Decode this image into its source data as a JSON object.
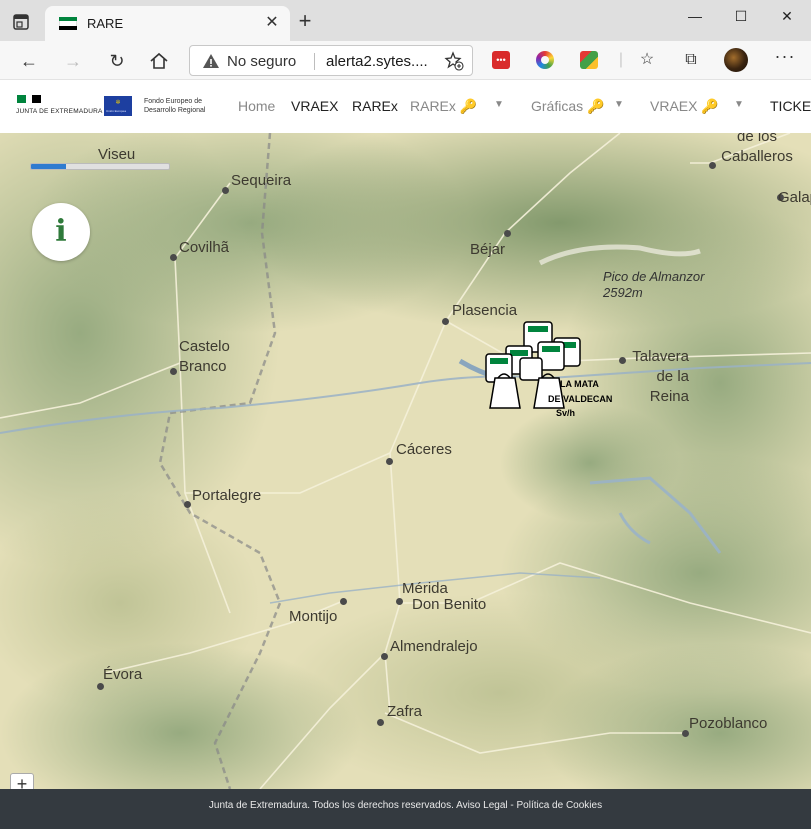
{
  "browser": {
    "tab_title": "RARE",
    "url_warning": "No seguro",
    "url_text": "alerta2.sytes....",
    "extensions": [
      "ext-icon-red",
      "ext-icon-ring",
      "ext-icon-colorful"
    ]
  },
  "site": {
    "brand_text": "JUNTA DE EXTREMADURA",
    "eu_text": "Unión Europea",
    "feder_text": "Fondo Europeo de\nDesarrollo Regional",
    "nav": [
      {
        "label": "Home",
        "active": false,
        "dropdown": false,
        "key": false
      },
      {
        "label": "VRAEX",
        "active": true,
        "dropdown": false,
        "key": false
      },
      {
        "label": "RAREx",
        "active": true,
        "dropdown": false,
        "key": false
      },
      {
        "label": "RAREx",
        "active": false,
        "dropdown": true,
        "key": true
      },
      {
        "label": "Gráficas",
        "active": false,
        "dropdown": true,
        "key": true
      },
      {
        "label": "VRAEX",
        "active": false,
        "dropdown": true,
        "key": true
      },
      {
        "label": "TICKE",
        "active": true,
        "dropdown": false,
        "key": false
      }
    ]
  },
  "map": {
    "progress": 0.25,
    "info_glyph": "i",
    "zoom_in": "+",
    "cities": [
      "Viseu",
      "Sequeira",
      "Covilhã",
      "Castelo Branco",
      "Portalegre",
      "Évora",
      "Béjar",
      "Plasencia",
      "Cáceres",
      "Mérida",
      "Don Benito",
      "Montijo",
      "Almendralejo",
      "Zafra",
      "Talavera de la Reina",
      "Pozoblanco",
      "de los Caballeros",
      "Galap"
    ],
    "peak": {
      "name": "Pico de Almanzor",
      "elevation": "2592m"
    },
    "cluster_labels": [
      "LA MATA",
      "DE VALDECAN",
      "Sv/h"
    ]
  },
  "footer": {
    "text": "Junta de Extremadura. Todos los derechos reservados. Aviso Legal - Política de Cookies"
  },
  "colors": {
    "extremadura_green": "#00843d",
    "footer_bg": "#343a40",
    "progress": "#2f7bd0"
  }
}
